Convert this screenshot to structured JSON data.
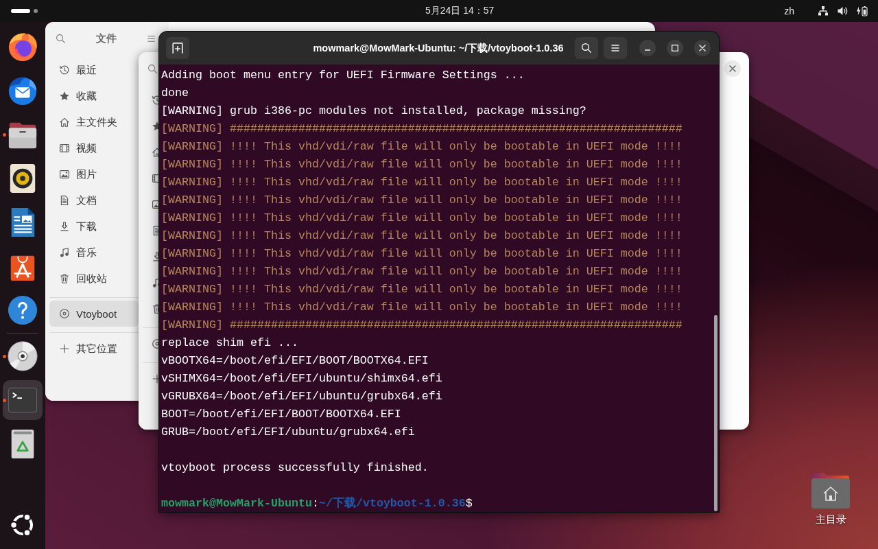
{
  "top_bar": {
    "clock": "5月24日 14：57",
    "input_method": "zh"
  },
  "dock": {
    "sections": [
      {
        "items": [
          {
            "kind": "browser",
            "running": false,
            "selected": false
          },
          {
            "kind": "mail",
            "running": false,
            "selected": false
          },
          {
            "kind": "files",
            "running": true,
            "selected": false
          },
          {
            "kind": "music",
            "running": false,
            "selected": false
          },
          {
            "kind": "writer",
            "running": false,
            "selected": false
          },
          {
            "kind": "store",
            "running": false,
            "selected": false
          },
          {
            "kind": "help",
            "running": false,
            "selected": false
          }
        ]
      },
      {
        "items": [
          {
            "kind": "disc",
            "running": true,
            "selected": false
          },
          {
            "kind": "terminal",
            "running": true,
            "selected": true
          },
          {
            "kind": "trash",
            "running": false,
            "selected": false
          }
        ]
      }
    ]
  },
  "files_window": {
    "title": "文件",
    "sidebar": {
      "sections": [
        {
          "items": [
            {
              "kind": "recent",
              "label": "最近",
              "selected": false
            },
            {
              "kind": "starred",
              "label": "收藏",
              "selected": false
            },
            {
              "kind": "home",
              "label": "主文件夹",
              "selected": false
            },
            {
              "kind": "videos",
              "label": "视频",
              "selected": false
            },
            {
              "kind": "pictures",
              "label": "图片",
              "selected": false
            },
            {
              "kind": "documents",
              "label": "文档",
              "selected": false
            },
            {
              "kind": "downloads",
              "label": "下载",
              "selected": false
            },
            {
              "kind": "music",
              "label": "音乐",
              "selected": false
            },
            {
              "kind": "trash",
              "label": "回收站",
              "selected": false
            }
          ]
        },
        {
          "items": [
            {
              "kind": "drive",
              "label": "Vtoyboot",
              "selected": true
            }
          ]
        },
        {
          "items": [
            {
              "kind": "other",
              "label": "其它位置",
              "selected": false
            }
          ]
        }
      ]
    }
  },
  "terminal": {
    "title": "mowmark@MowMark-Ubuntu: ~/下载/vtoyboot-1.0.36",
    "lines": [
      {
        "kind": "output",
        "text": "Adding boot menu entry for UEFI Firmware Settings ..."
      },
      {
        "kind": "output",
        "text": "done"
      },
      {
        "kind": "output",
        "text": "[WARNING] grub i386-pc modules not installed, package missing?"
      },
      {
        "kind": "warning",
        "text": "[WARNING] ##################################################################"
      },
      {
        "kind": "warning",
        "text": "[WARNING] !!!! This vhd/vdi/raw file will only be bootable in UEFI mode !!!!"
      },
      {
        "kind": "warning",
        "text": "[WARNING] !!!! This vhd/vdi/raw file will only be bootable in UEFI mode !!!!"
      },
      {
        "kind": "warning",
        "text": "[WARNING] !!!! This vhd/vdi/raw file will only be bootable in UEFI mode !!!!"
      },
      {
        "kind": "warning",
        "text": "[WARNING] !!!! This vhd/vdi/raw file will only be bootable in UEFI mode !!!!"
      },
      {
        "kind": "warning",
        "text": "[WARNING] !!!! This vhd/vdi/raw file will only be bootable in UEFI mode !!!!"
      },
      {
        "kind": "warning",
        "text": "[WARNING] !!!! This vhd/vdi/raw file will only be bootable in UEFI mode !!!!"
      },
      {
        "kind": "warning",
        "text": "[WARNING] !!!! This vhd/vdi/raw file will only be bootable in UEFI mode !!!!"
      },
      {
        "kind": "warning",
        "text": "[WARNING] !!!! This vhd/vdi/raw file will only be bootable in UEFI mode !!!!"
      },
      {
        "kind": "warning",
        "text": "[WARNING] !!!! This vhd/vdi/raw file will only be bootable in UEFI mode !!!!"
      },
      {
        "kind": "warning",
        "text": "[WARNING] !!!! This vhd/vdi/raw file will only be bootable in UEFI mode !!!!"
      },
      {
        "kind": "warning",
        "text": "[WARNING] ##################################################################"
      },
      {
        "kind": "output",
        "text": "replace shim efi ..."
      },
      {
        "kind": "output",
        "text": "vBOOTX64=/boot/efi/EFI/BOOT/BOOTX64.EFI"
      },
      {
        "kind": "output",
        "text": "vSHIMX64=/boot/efi/EFI/ubuntu/shimx64.efi"
      },
      {
        "kind": "output",
        "text": "vGRUBX64=/boot/efi/EFI/ubuntu/grubx64.efi"
      },
      {
        "kind": "output",
        "text": "BOOT=/boot/efi/EFI/BOOT/BOOTX64.EFI"
      },
      {
        "kind": "output",
        "text": "GRUB=/boot/efi/EFI/ubuntu/grubx64.efi"
      },
      {
        "kind": "blank"
      },
      {
        "kind": "output",
        "text": "vtoyboot process successfully finished."
      },
      {
        "kind": "blank"
      }
    ],
    "prompt": {
      "user_host": "mowmark@MowMark-Ubuntu",
      "separator": ":",
      "path": "~/下载/vtoyboot-1.0.36",
      "symbol": "$"
    }
  },
  "desktop": {
    "icons": [
      {
        "label": "主目录"
      }
    ]
  }
}
